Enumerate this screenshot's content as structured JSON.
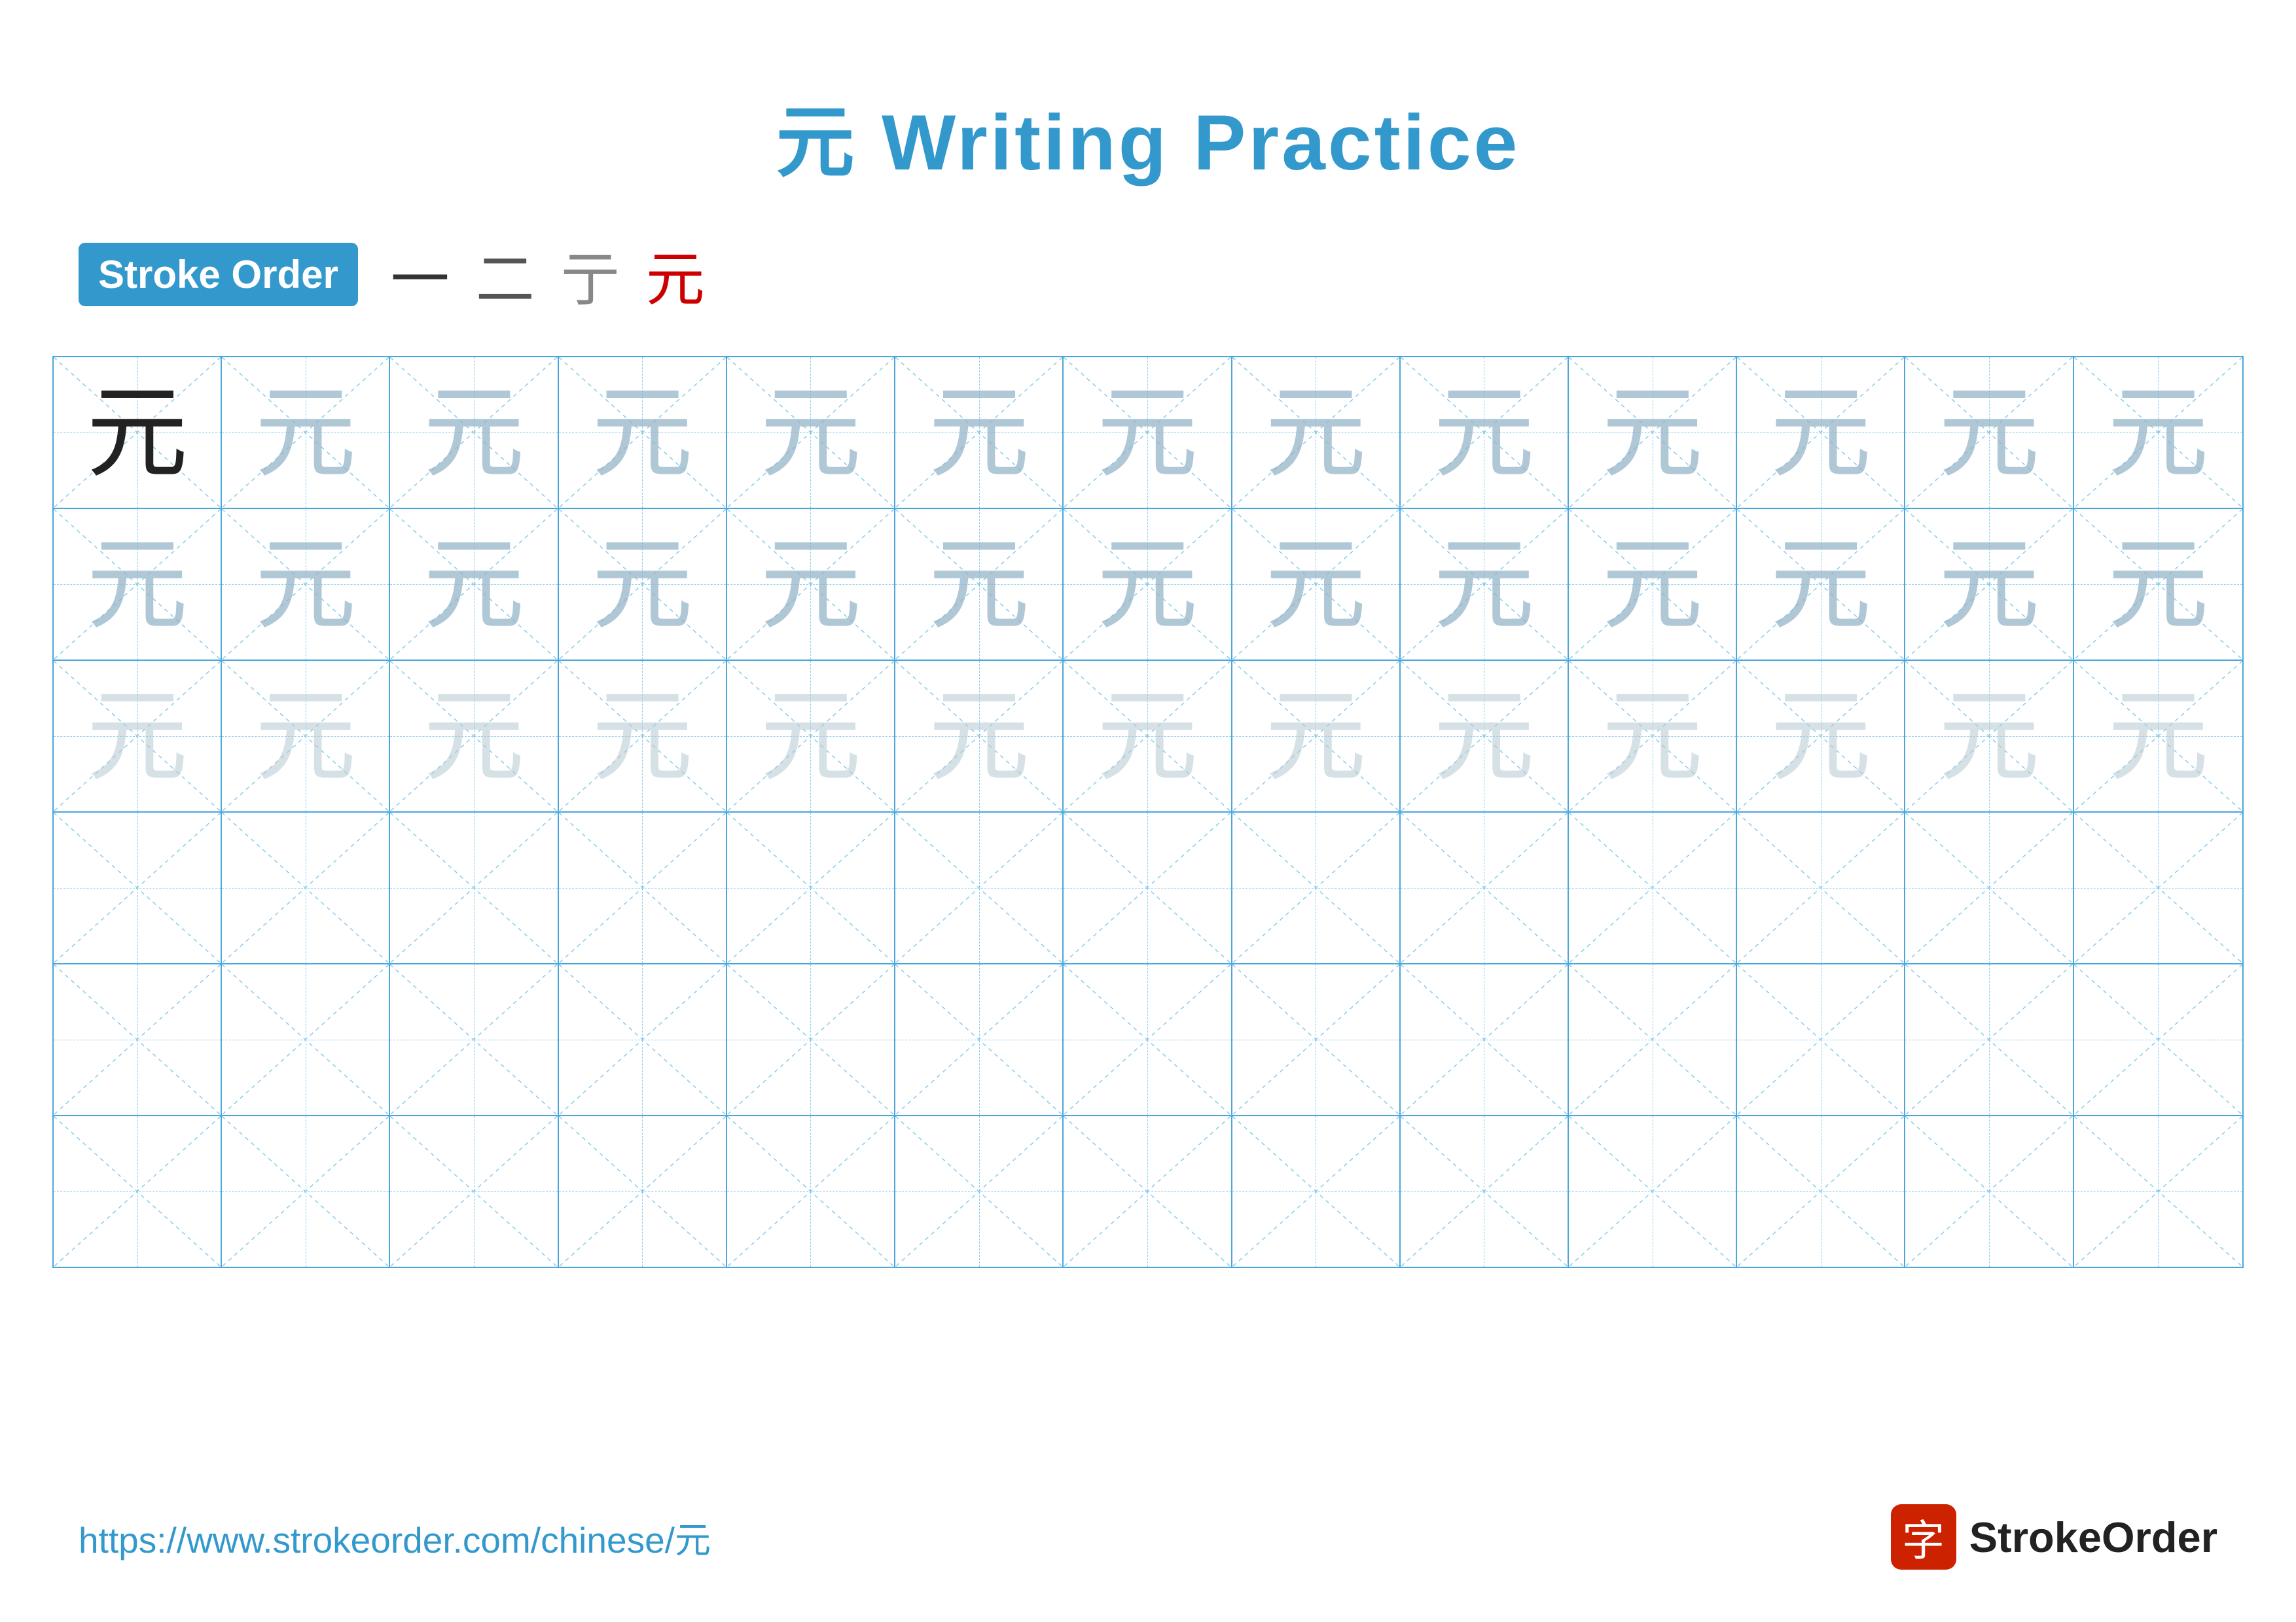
{
  "page": {
    "title": "元 Writing Practice",
    "title_char": "元",
    "title_text": "Writing Practice",
    "stroke_order_label": "Stroke Order",
    "strokes": [
      "一",
      "二",
      "亍",
      "元"
    ],
    "char": "元",
    "url": "https://www.strokeorder.com/chinese/元",
    "logo_text": "StrokeOrder",
    "logo_char": "字",
    "rows": 6,
    "cols": 13
  },
  "grid": {
    "row1": [
      "solid",
      "faded_dark",
      "faded_dark",
      "faded_dark",
      "faded_dark",
      "faded_dark",
      "faded_dark",
      "faded_dark",
      "faded_dark",
      "faded_dark",
      "faded_dark",
      "faded_dark",
      "faded_dark"
    ],
    "row2": [
      "faded_dark",
      "faded_dark",
      "faded_dark",
      "faded_dark",
      "faded_dark",
      "faded_dark",
      "faded_dark",
      "faded_dark",
      "faded_dark",
      "faded_dark",
      "faded_dark",
      "faded_dark",
      "faded_dark"
    ],
    "row3": [
      "faded_light",
      "faded_light",
      "faded_light",
      "faded_light",
      "faded_light",
      "faded_light",
      "faded_light",
      "faded_light",
      "faded_light",
      "faded_light",
      "faded_light",
      "faded_light",
      "faded_light"
    ],
    "row4": [
      "empty",
      "empty",
      "empty",
      "empty",
      "empty",
      "empty",
      "empty",
      "empty",
      "empty",
      "empty",
      "empty",
      "empty",
      "empty"
    ],
    "row5": [
      "empty",
      "empty",
      "empty",
      "empty",
      "empty",
      "empty",
      "empty",
      "empty",
      "empty",
      "empty",
      "empty",
      "empty",
      "empty"
    ],
    "row6": [
      "empty",
      "empty",
      "empty",
      "empty",
      "empty",
      "empty",
      "empty",
      "empty",
      "empty",
      "empty",
      "empty",
      "empty",
      "empty"
    ]
  },
  "colors": {
    "title": "#3399cc",
    "badge_bg": "#3399cc",
    "grid_border": "#4da6d9",
    "dashed": "#88ccee",
    "char_solid": "#222222",
    "char_faded_dark": "rgba(150,180,200,0.75)",
    "char_faded_light": "rgba(180,200,210,0.55)",
    "stroke4_color": "#cc0000",
    "footer_url": "#3399cc",
    "logo_bg": "#cc2200"
  }
}
